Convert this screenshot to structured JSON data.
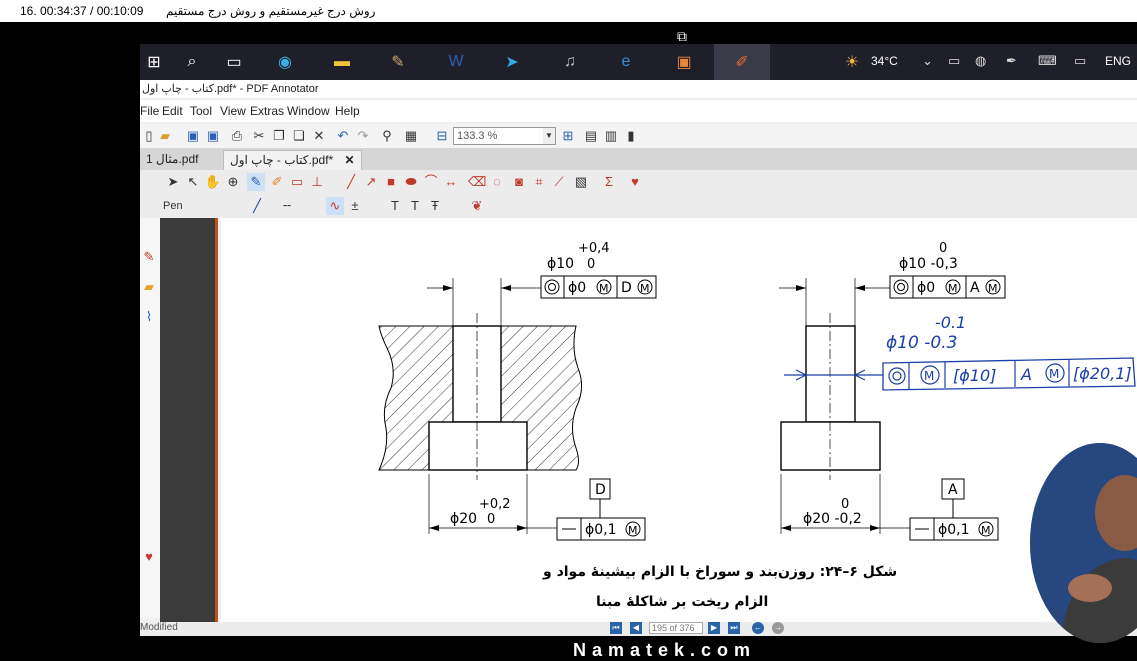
{
  "player": {
    "time_text": "16. 00:34:37 / 00:10:09",
    "video_title": "روش درج غیرمستقیم و روش درج مستقیم"
  },
  "taskbar": {
    "weather": "34°C",
    "language": "ENG"
  },
  "window": {
    "title": "کتاب - چاپ اول.pdf* - PDF Annotator"
  },
  "menu": [
    "File",
    "Edit",
    "Tool",
    "View",
    "Extras",
    "Window",
    "Help"
  ],
  "toolbar": {
    "zoom": "133.3 %"
  },
  "tabs": [
    {
      "label": "مثال 1.pdf"
    },
    {
      "label": "کتاب - چاپ اول.pdf*"
    }
  ],
  "pen_toolbar": {
    "label": "Pen"
  },
  "drawing": {
    "left": {
      "tol_upper": "+0,4",
      "tol_lower": "0",
      "dim_hole": "ϕ10",
      "frame_val": "ϕ0",
      "frame_datum": "D",
      "bottom_tol_upper": "+0,2",
      "bottom_tol_lower": "0",
      "dim_bottom": "ϕ20",
      "datum_box": "D",
      "bottom_frame_val": "ϕ0,1"
    },
    "right": {
      "tol_upper": "0",
      "dim_top": "ϕ10 -0,3",
      "frame_val": "ϕ0",
      "frame_datum": "A",
      "bottom_tol_upper": "0",
      "dim_bottom": "ϕ20 -0,2",
      "datum_box": "A",
      "bottom_frame_val": "ϕ0,1"
    },
    "handwritten": {
      "line1": "-0.1",
      "line2": "ϕ10 -0.3",
      "frame_v1": "[ϕ10]",
      "frame_v2": "A",
      "frame_v3": "[ϕ20,1]"
    },
    "caption_line1": "شکل ۶–۲۴: روزن‌بند و سوراخ با الزام بیشینهٔ مواد و",
    "caption_line2": "الزام ریخت بر شاکلهٔ مبنا"
  },
  "status": {
    "modified": "Modified",
    "page_counter": "195 of 376"
  },
  "watermark": "Namatek.com"
}
